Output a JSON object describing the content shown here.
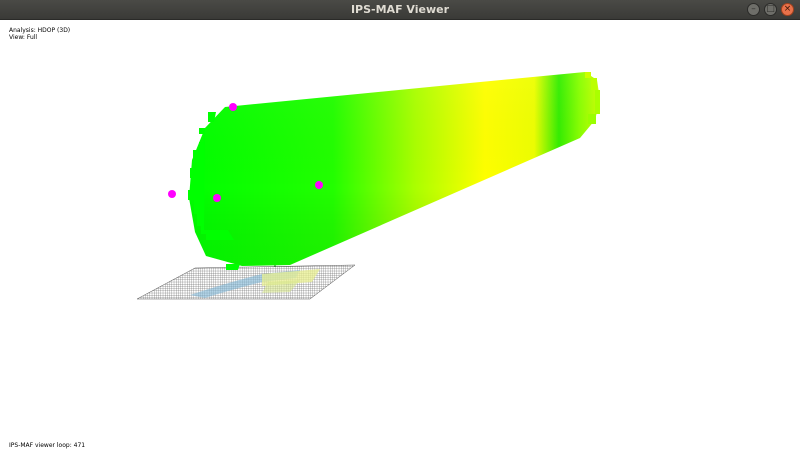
{
  "window": {
    "title": "IPS-MAF Viewer",
    "buttons": {
      "minimize_icon": "minimize-icon",
      "maximize_icon": "maximize-icon",
      "close_icon": "close-icon"
    }
  },
  "overlay": {
    "analysis": "Analysis: HDOP (3D)",
    "view": "View: Full",
    "loop": "IPS-MAF viewer loop: 471"
  },
  "colors": {
    "beam_green": "#00ff00",
    "beam_yellow": "#ffff00",
    "marker": "#ff00ff",
    "mesh": "#444444",
    "titlebar": "#3c3b37",
    "close_button": "#e9714a"
  }
}
